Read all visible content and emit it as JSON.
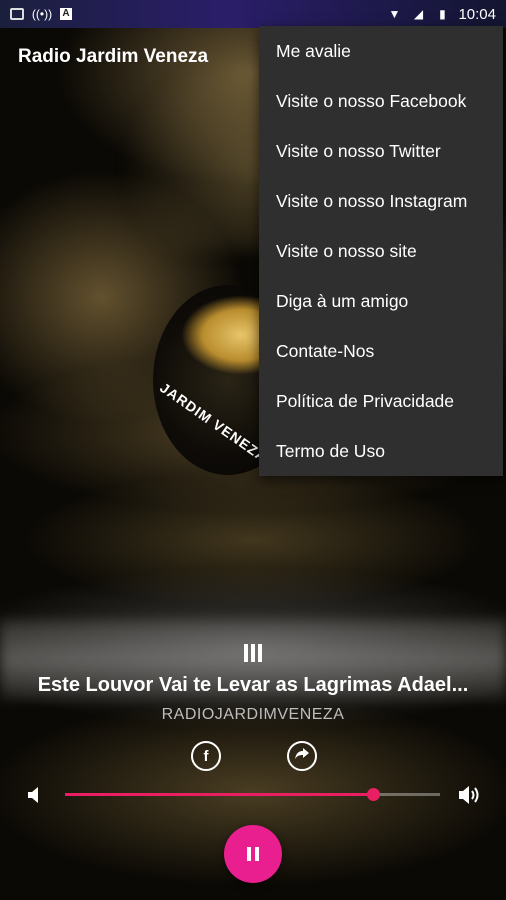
{
  "status_bar": {
    "time": "10:04",
    "icons": [
      "image-notification-icon",
      "radio-broadcast-icon",
      "a-app-icon",
      "wifi-icon",
      "signal-icon",
      "battery-icon"
    ]
  },
  "app_bar": {
    "title": "Radio Jardim Veneza"
  },
  "album_art": {
    "text": "JARDIM VENEZA"
  },
  "overflow_menu": {
    "items": [
      {
        "label": "Me avalie"
      },
      {
        "label": "Visite o nosso Facebook"
      },
      {
        "label": "Visite o nosso Twitter"
      },
      {
        "label": "Visite o nosso Instagram"
      },
      {
        "label": "Visite o nosso site"
      },
      {
        "label": "Diga à um amigo"
      },
      {
        "label": "Contate-Nos"
      },
      {
        "label": "Política de Privacidade"
      },
      {
        "label": "Termo de Uso"
      }
    ]
  },
  "player": {
    "track_title": "Este Louvor Vai te Levar as Lagrimas Adael...",
    "artist": "RADIOJARDIMVENEZA",
    "facebook_label": "f",
    "volume_level": 0.82,
    "accent_color": "#e91e63",
    "play_button_color": "#e91e8f"
  }
}
